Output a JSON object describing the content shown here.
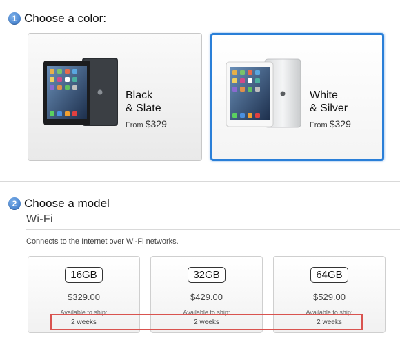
{
  "step1": {
    "number": "1",
    "title": "Choose a color:"
  },
  "colors": [
    {
      "name": "Black\n& Slate",
      "from_label": "From",
      "price": "$329",
      "selected": false
    },
    {
      "name": "White\n& Silver",
      "from_label": "From",
      "price": "$329",
      "selected": true
    }
  ],
  "step2": {
    "number": "2",
    "title": "Choose a model"
  },
  "section": {
    "label": "Wi-Fi",
    "description": "Connects to the Internet over Wi-Fi networks."
  },
  "models": [
    {
      "capacity": "16GB",
      "price": "$329.00",
      "ship_label": "Available to ship:",
      "ship_value": "2 weeks"
    },
    {
      "capacity": "32GB",
      "price": "$429.00",
      "ship_label": "Available to ship:",
      "ship_value": "2 weeks"
    },
    {
      "capacity": "64GB",
      "price": "$529.00",
      "ship_label": "Available to ship:",
      "ship_value": "2 weeks"
    }
  ],
  "colors_palette": {
    "selected_border": "#2a7fd8",
    "highlight": "#d9534f"
  }
}
